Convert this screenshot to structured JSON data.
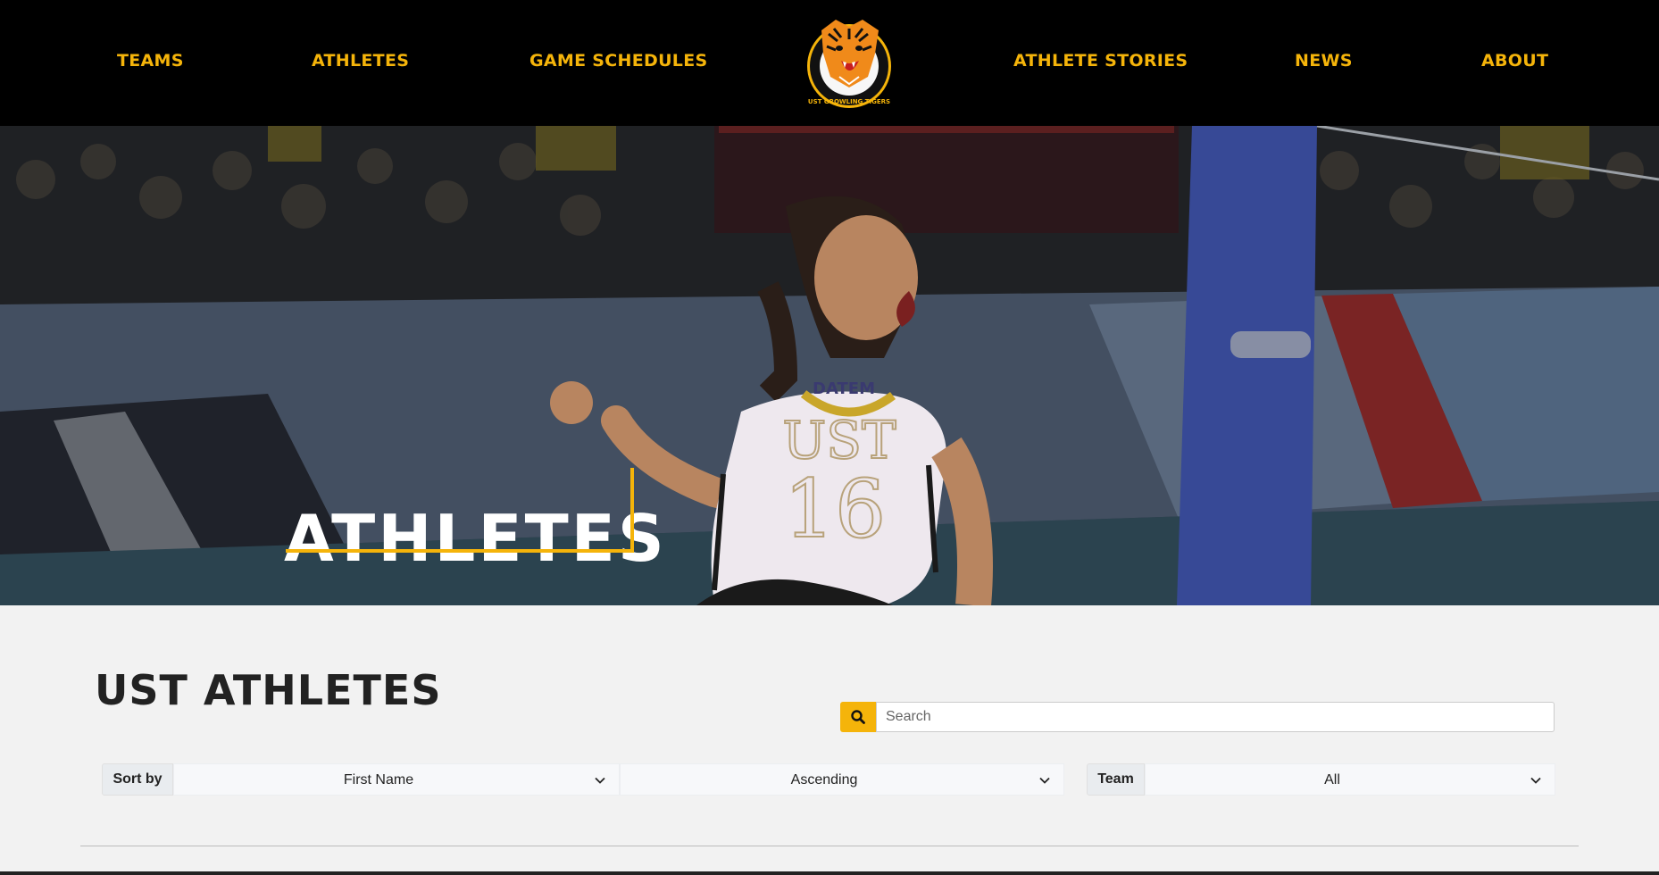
{
  "nav": {
    "left": [
      "TEAMS",
      "ATHLETES",
      "GAME SCHEDULES"
    ],
    "right": [
      "ATHLETE STORIES",
      "NEWS",
      "ABOUT"
    ],
    "logo_text": "UST GROWLING TIGERS"
  },
  "hero": {
    "title": "ATHLETES",
    "jersey_sponsor": "DATEM",
    "jersey_letters": "UST",
    "jersey_number": "16"
  },
  "main": {
    "section_title": "UST ATHLETES",
    "search": {
      "placeholder": "Search",
      "value": ""
    },
    "sort": {
      "label": "Sort by",
      "field": "First Name",
      "order": "Ascending"
    },
    "team": {
      "label": "Team",
      "value": "All"
    }
  },
  "colors": {
    "accent": "#f5b40a",
    "nav_bg": "#000000",
    "page_bg": "#f2f2f2"
  },
  "icons": {
    "search": "search-icon",
    "dropdown": "chevron-down-icon",
    "logo": "tiger-logo-icon"
  }
}
